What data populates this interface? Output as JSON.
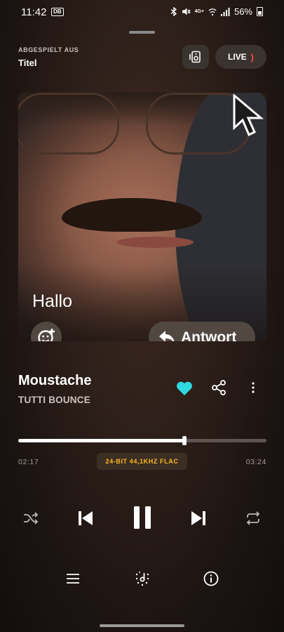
{
  "status_bar": {
    "time": "11:42",
    "badge": "DB",
    "network": "4G+",
    "battery": "56%"
  },
  "header": {
    "source_label": "ABGESPIELT AUS",
    "source_value": "Titel",
    "cast_icon": "speaker-device-icon",
    "live_label": "LIVE",
    "live_icon": "live-broadcast-icon",
    "live_color": "#ff4a3d"
  },
  "cover": {
    "overlay_text": "Hallo",
    "reaction_icon": "add-reaction-icon",
    "reply_label": "Antwort",
    "reply_icon": "reply-arrow-icon",
    "cursor_icon": "cursor-arrow-icon"
  },
  "track": {
    "title": "Moustache",
    "artist": "TUTTI BOUNCE",
    "favorite": true,
    "favorite_color": "#2fd9e0"
  },
  "playback": {
    "elapsed": "02:17",
    "total": "03:24",
    "progress": 0.67,
    "quality": "24-BIT 44,1KHZ FLAC",
    "quality_color": "#ffb820",
    "state": "playing"
  },
  "controls": {
    "shuffle_icon": "shuffle-icon",
    "previous_icon": "skip-previous-icon",
    "pause_icon": "pause-icon",
    "next_icon": "skip-next-icon",
    "repeat_icon": "repeat-icon"
  },
  "bottom_bar": {
    "queue_icon": "queue-list-icon",
    "flow_icon": "deezer-flow-icon",
    "info_icon": "info-icon"
  }
}
